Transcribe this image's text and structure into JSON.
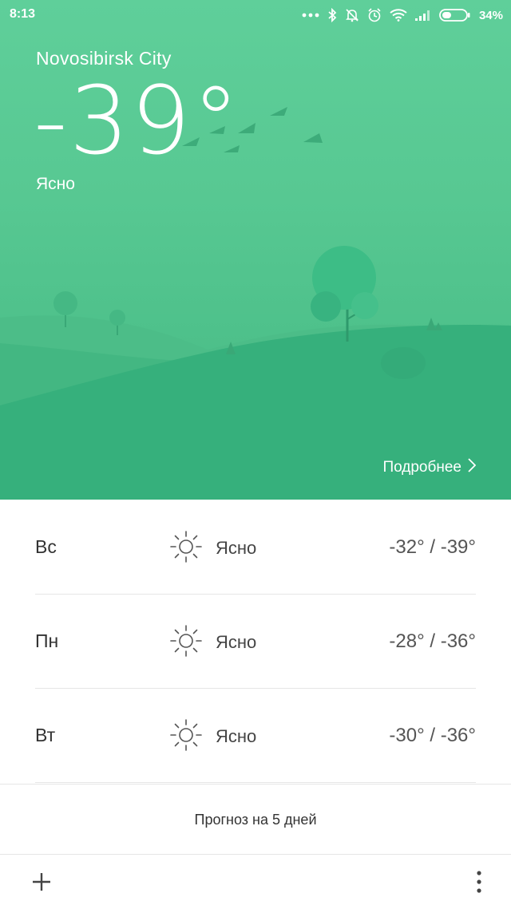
{
  "status_bar": {
    "time": "8:13",
    "battery": "34%",
    "icons": [
      "more-dots-icon",
      "bluetooth-icon",
      "mute-icon",
      "alarm-icon",
      "wifi-icon",
      "signal-icon",
      "battery-icon"
    ]
  },
  "current": {
    "city": "Novosibirsk City",
    "temperature": "-39°",
    "condition": "Ясно",
    "more_label": "Подробнее"
  },
  "forecast": [
    {
      "day": "Вс",
      "icon": "sun-icon",
      "condition": "Ясно",
      "range": "-32° / -39°"
    },
    {
      "day": "Пн",
      "icon": "sun-icon",
      "condition": "Ясно",
      "range": "-28° / -36°"
    },
    {
      "day": "Вт",
      "icon": "sun-icon",
      "condition": "Ясно",
      "range": "-30° / -36°"
    }
  ],
  "five_day_label": "Прогноз на 5 дней",
  "colors": {
    "hero_top": "#5fcf9a",
    "hero_bottom": "#43b985",
    "hill_front": "#34b07c",
    "tree": "#3dbd86"
  }
}
